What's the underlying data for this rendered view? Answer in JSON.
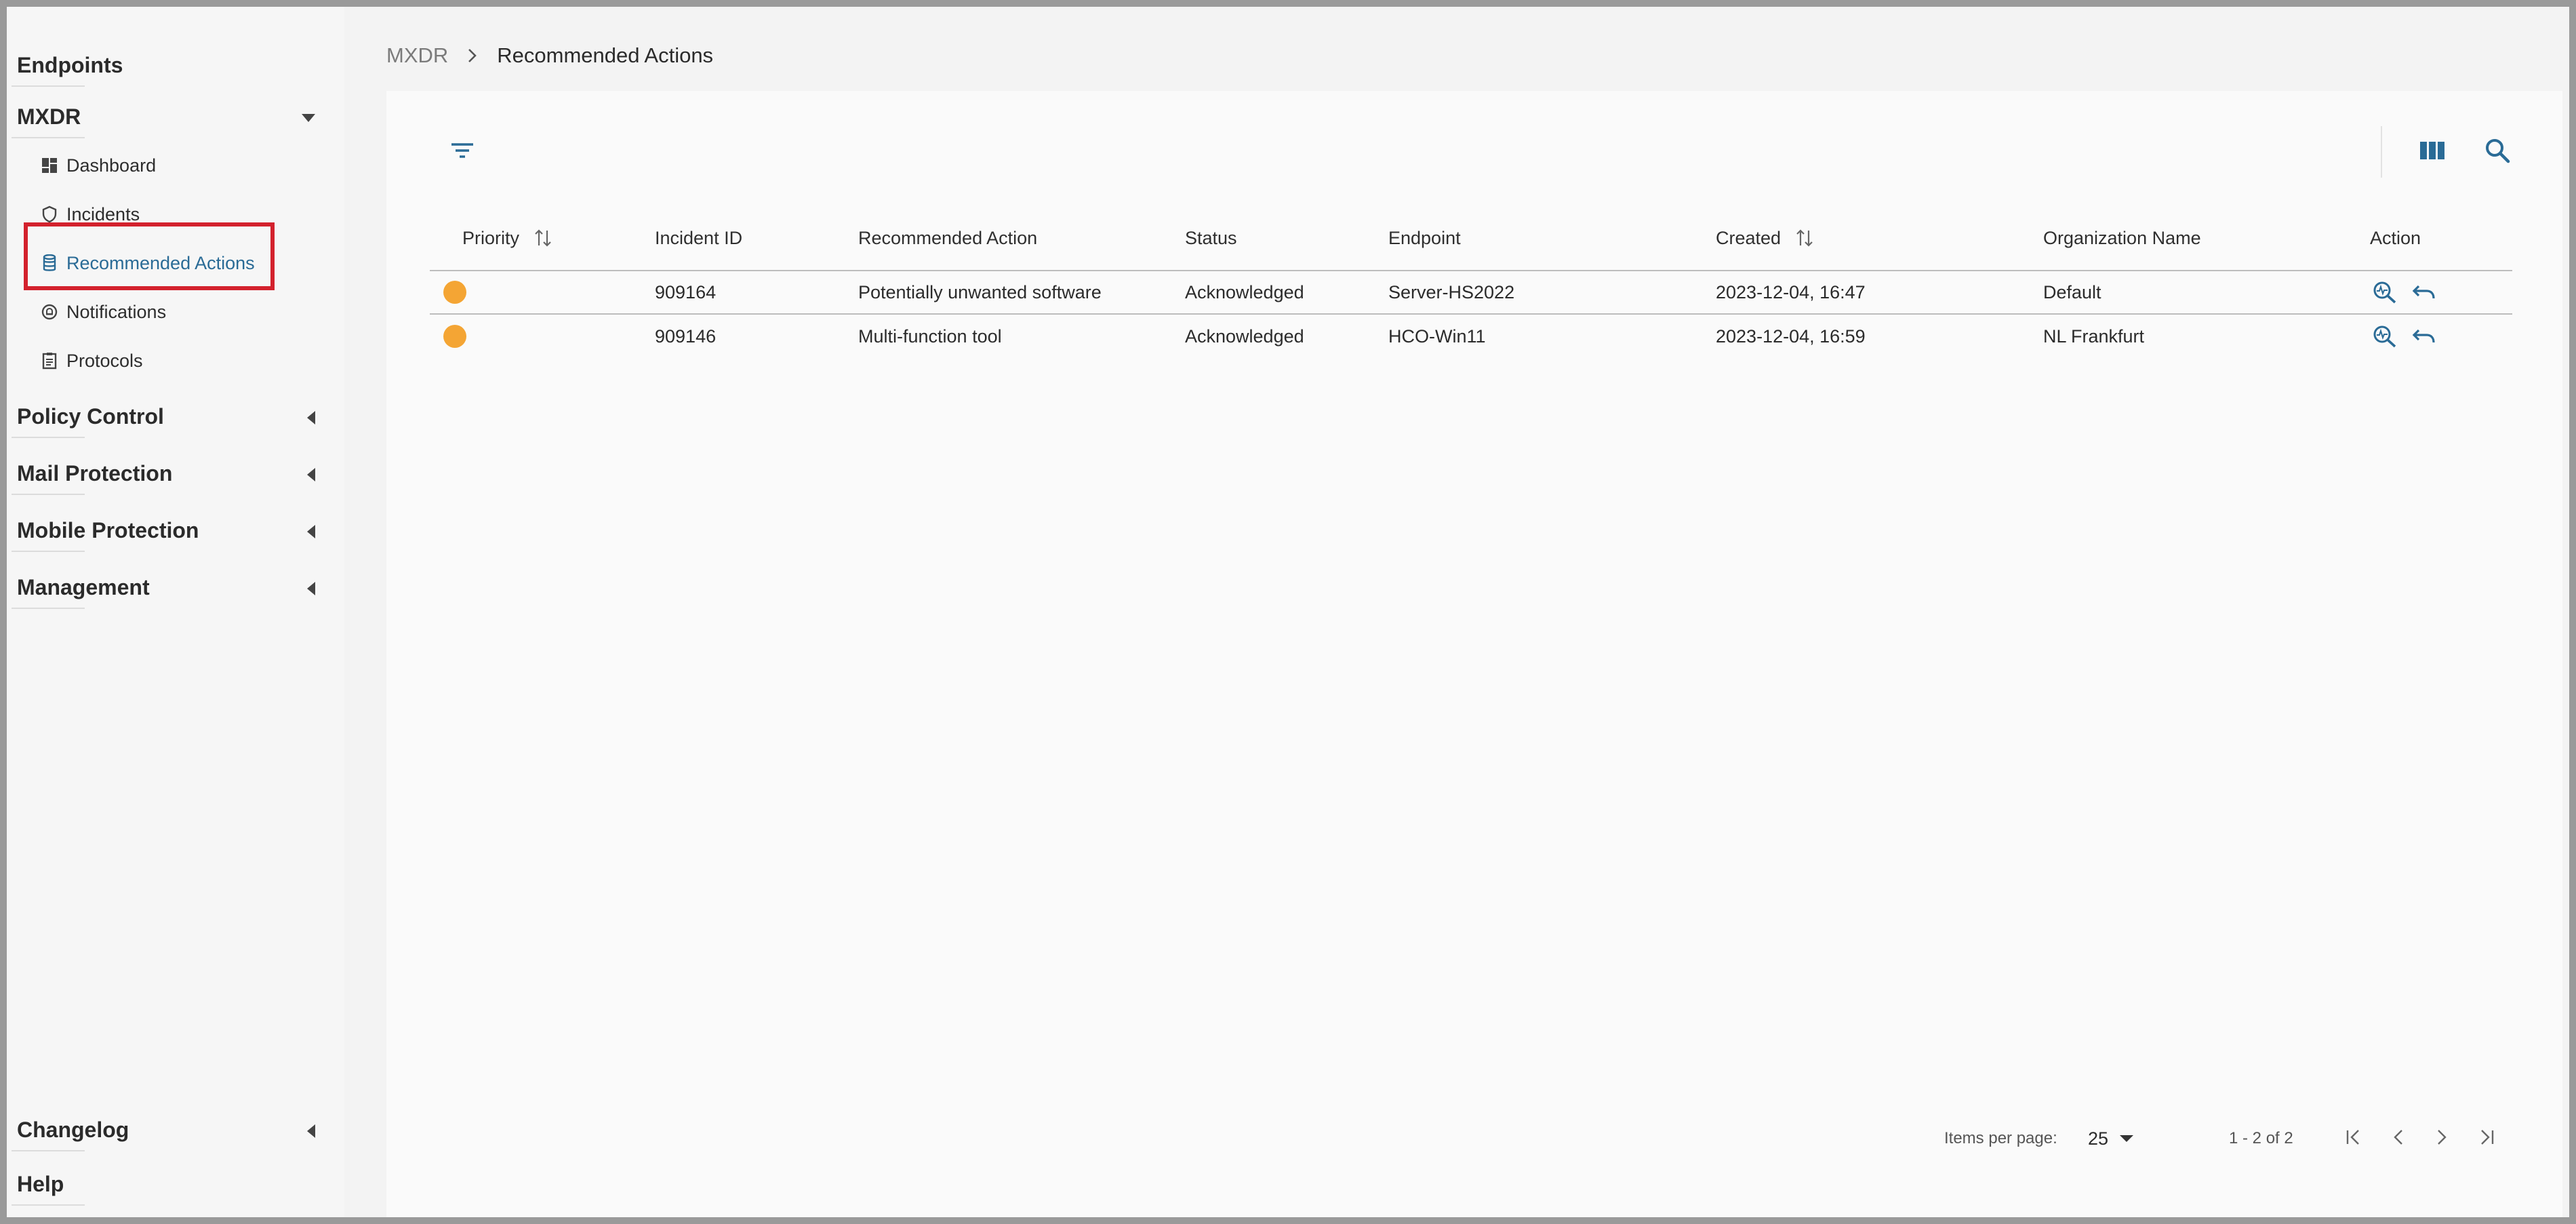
{
  "sidebar": {
    "endpoints_label": "Endpoints",
    "mxdr_label": "MXDR",
    "mxdr_items": [
      {
        "label": "Dashboard",
        "icon": "dashboard-icon"
      },
      {
        "label": "Incidents",
        "icon": "shield-icon"
      },
      {
        "label": "Recommended Actions",
        "icon": "database-icon",
        "active": true
      },
      {
        "label": "Notifications",
        "icon": "bell-icon"
      },
      {
        "label": "Protocols",
        "icon": "clipboard-icon"
      }
    ],
    "sections": [
      {
        "label": "Policy Control"
      },
      {
        "label": "Mail Protection"
      },
      {
        "label": "Mobile Protection"
      },
      {
        "label": "Management"
      }
    ],
    "changelog_label": "Changelog",
    "help_label": "Help"
  },
  "breadcrumb": {
    "parent": "MXDR",
    "current": "Recommended Actions"
  },
  "table": {
    "columns": [
      "Priority",
      "Incident ID",
      "Recommended Action",
      "Status",
      "Endpoint",
      "Created",
      "Organization Name",
      "Action"
    ],
    "rows": [
      {
        "priority_color": "#f4a534",
        "incident_id": "909164",
        "action": "Potentially unwanted software",
        "status": "Acknowledged",
        "endpoint": "Server-HS2022",
        "created": "2023-12-04, 16:47",
        "org": "Default"
      },
      {
        "priority_color": "#f4a534",
        "incident_id": "909146",
        "action": "Multi-function tool",
        "status": "Acknowledged",
        "endpoint": "HCO-Win11",
        "created": "2023-12-04, 16:59",
        "org": "NL Frankfurt"
      }
    ]
  },
  "paginator": {
    "items_per_page_label": "Items per page:",
    "page_size": "25",
    "range_label": "1 - 2 of 2"
  },
  "colors": {
    "accent": "#2a6b96",
    "highlight": "#d3212d",
    "priority_medium": "#f4a534"
  }
}
